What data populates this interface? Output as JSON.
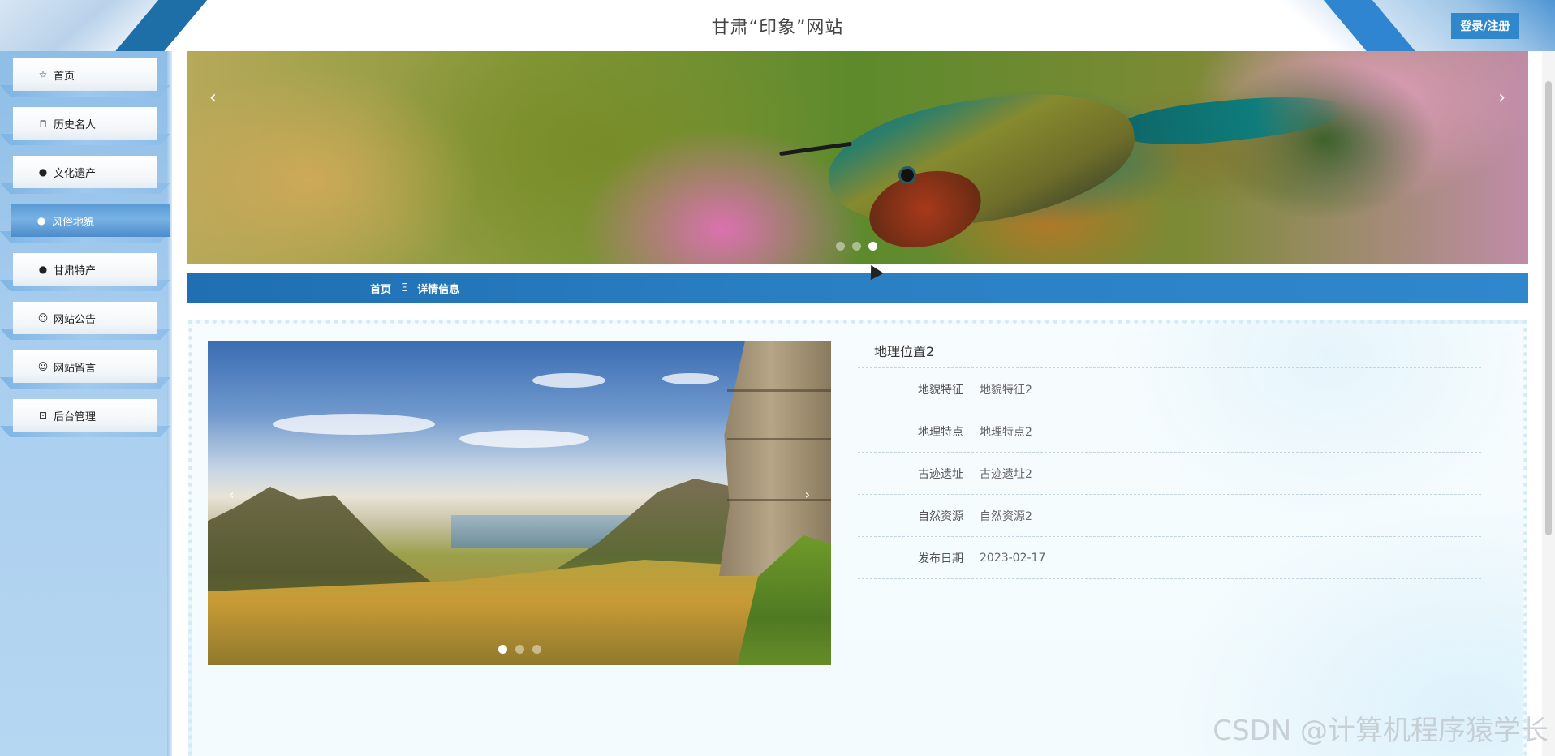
{
  "header": {
    "title": "甘肃“印象”网站",
    "login_label": "登录/注册"
  },
  "sidebar": {
    "items": [
      {
        "label": "首页",
        "icon": "star-icon",
        "glyph": "☆"
      },
      {
        "label": "历史名人",
        "icon": "bag-icon",
        "glyph": "⊓"
      },
      {
        "label": "文化遗产",
        "icon": "exclamation-circle-icon",
        "glyph": "●"
      },
      {
        "label": "风俗地貌",
        "icon": "circle-icon",
        "glyph": "●",
        "active": true
      },
      {
        "label": "甘肃特产",
        "icon": "info-circle-icon",
        "glyph": "●"
      },
      {
        "label": "网站公告",
        "icon": "smile-icon",
        "glyph": "☺"
      },
      {
        "label": "网站留言",
        "icon": "smile-outline-icon",
        "glyph": "☺"
      },
      {
        "label": "后台管理",
        "icon": "gift-icon",
        "glyph": "⊡"
      }
    ]
  },
  "banner": {
    "prev_glyph": "‹",
    "next_glyph": "›",
    "slide_count": 3,
    "active_slide": 3
  },
  "breadcrumb": {
    "home": "首页",
    "separator": "Ξ",
    "current": "详情信息"
  },
  "detail": {
    "title": "地理位置2",
    "rows": [
      {
        "label": "地貌特征",
        "value": "地貌特征2"
      },
      {
        "label": "地理特点",
        "value": "地理特点2"
      },
      {
        "label": "古迹遗址",
        "value": "古迹遗址2"
      },
      {
        "label": "自然资源",
        "value": "自然资源2"
      },
      {
        "label": "发布日期",
        "value": "2023-02-17"
      }
    ],
    "photo_prev_glyph": "‹",
    "photo_next_glyph": "›",
    "photo_slide_count": 3,
    "photo_active_slide": 1
  },
  "watermark": "CSDN @计算机程序猿学长",
  "colors": {
    "primary": "#2f87cc",
    "sidebar_bg": "#a8cdee",
    "active_nav": "#5a9ad6"
  }
}
